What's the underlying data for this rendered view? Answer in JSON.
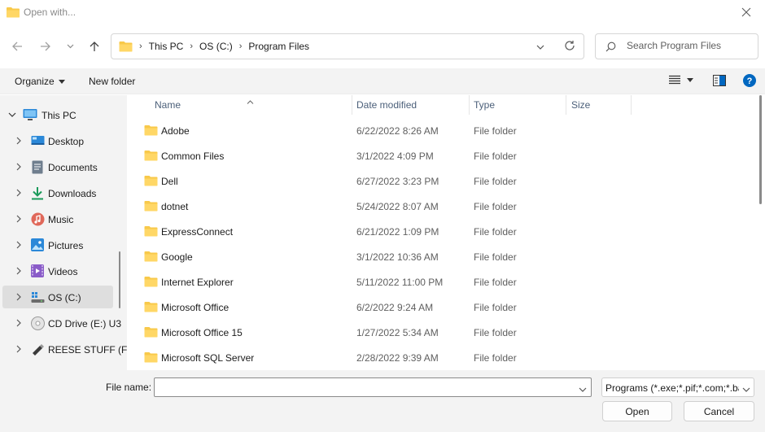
{
  "window": {
    "title": "Open with..."
  },
  "nav": {
    "back_icon": "arrow-left-icon",
    "forward_icon": "arrow-right-icon",
    "recent_icon": "chevron-down-icon",
    "up_icon": "arrow-up-icon"
  },
  "address": {
    "breadcrumbs": [
      "This PC",
      "OS (C:)",
      "Program Files"
    ]
  },
  "search": {
    "placeholder": "Search Program Files"
  },
  "commandbar": {
    "organize_label": "Organize",
    "new_folder_label": "New folder"
  },
  "sidebar": {
    "items": [
      {
        "label": "This PC",
        "icon": "computer-icon"
      },
      {
        "label": "Desktop",
        "icon": "desktop-icon"
      },
      {
        "label": "Documents",
        "icon": "documents-icon"
      },
      {
        "label": "Downloads",
        "icon": "downloads-icon"
      },
      {
        "label": "Music",
        "icon": "music-icon"
      },
      {
        "label": "Pictures",
        "icon": "pictures-icon"
      },
      {
        "label": "Videos",
        "icon": "videos-icon"
      },
      {
        "label": "OS (C:)",
        "icon": "drive-icon"
      },
      {
        "label": "CD Drive (E:) U3",
        "icon": "cd-drive-icon"
      },
      {
        "label": "REESE STUFF (F:",
        "icon": "usb-drive-icon"
      }
    ]
  },
  "filelist": {
    "columns": [
      "Name",
      "Date modified",
      "Type",
      "Size"
    ],
    "rows": [
      {
        "name": "Adobe",
        "date": "6/22/2022 8:26 AM",
        "type": "File folder"
      },
      {
        "name": "Common Files",
        "date": "3/1/2022 4:09 PM",
        "type": "File folder"
      },
      {
        "name": "Dell",
        "date": "6/27/2022 3:23 PM",
        "type": "File folder"
      },
      {
        "name": "dotnet",
        "date": "5/24/2022 8:07 AM",
        "type": "File folder"
      },
      {
        "name": "ExpressConnect",
        "date": "6/21/2022 1:09 PM",
        "type": "File folder"
      },
      {
        "name": "Google",
        "date": "3/1/2022 10:36 AM",
        "type": "File folder"
      },
      {
        "name": "Internet Explorer",
        "date": "5/11/2022 11:00 PM",
        "type": "File folder"
      },
      {
        "name": "Microsoft Office",
        "date": "6/2/2022 9:24 AM",
        "type": "File folder"
      },
      {
        "name": "Microsoft Office 15",
        "date": "1/27/2022 5:34 AM",
        "type": "File folder"
      },
      {
        "name": "Microsoft SQL Server",
        "date": "2/28/2022 9:39 AM",
        "type": "File folder"
      }
    ]
  },
  "footer": {
    "file_name_label": "File name:",
    "file_name_value": "",
    "filter_value": "Programs (*.exe;*.pif;*.com;*.bat;*.cmd)",
    "open_label": "Open",
    "cancel_label": "Cancel"
  },
  "colors": {
    "folder": "#f8c94a",
    "accent": "#0067c0",
    "selected_bg": "#dedede"
  }
}
